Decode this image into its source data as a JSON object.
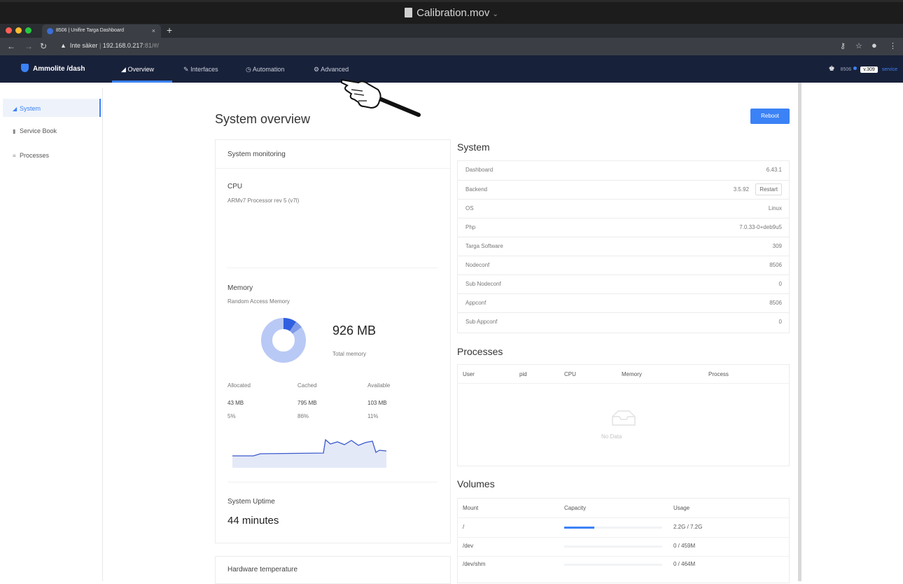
{
  "player": {
    "title": "Calibration.mov"
  },
  "browser": {
    "tab_title": "8506 | Unifire Targa Dashboard",
    "tab_close": "×",
    "new_tab": "+",
    "insecure": "Inte säker",
    "url_host": "192.168.0.217",
    "url_rest": ":81/#/"
  },
  "app": {
    "brand": "Ammolite /dash",
    "nav": {
      "overview": "Overview",
      "interfaces": "Interfaces",
      "automation": "Automation",
      "advanced": "Advanced"
    },
    "node": "8506",
    "version": "v.309",
    "service": "service"
  },
  "sidebar": {
    "items": [
      {
        "label": "System"
      },
      {
        "label": "Service Book"
      },
      {
        "label": "Processes"
      }
    ]
  },
  "page": {
    "title": "System overview",
    "reboot": "Reboot"
  },
  "monitoring": {
    "header": "System monitoring",
    "cpu_title": "CPU",
    "cpu_desc": "ARMv7 Processor rev 5 (v7l)",
    "mem_title": "Memory",
    "mem_desc": "Random Access Memory",
    "total": "926 MB",
    "total_label": "Total memory",
    "cols": [
      "Allocated",
      "Cached",
      "Available"
    ],
    "values": [
      "43 MB",
      "795 MB",
      "103 MB"
    ],
    "percents": [
      "5%",
      "86%",
      "11%"
    ],
    "alloc_pct": 5,
    "cached_pct": 86,
    "avail_pct": 11,
    "uptime_title": "System Uptime",
    "uptime": "44 minutes",
    "hw_title": "Hardware temperature"
  },
  "system": {
    "title": "System",
    "rows": [
      {
        "k": "Dashboard",
        "v": "6.43.1"
      },
      {
        "k": "Backend",
        "v": "3.5.92"
      },
      {
        "k": "OS",
        "v": "Linux"
      },
      {
        "k": "Php",
        "v": "7.0.33-0+deb9u5"
      },
      {
        "k": "Targa Software",
        "v": "309"
      },
      {
        "k": "Nodeconf",
        "v": "8506"
      },
      {
        "k": "Sub Nodeconf",
        "v": "0"
      },
      {
        "k": "Appconf",
        "v": "8506"
      },
      {
        "k": "Sub Appconf",
        "v": "0"
      }
    ],
    "restart": "Restart"
  },
  "processes": {
    "title": "Processes",
    "cols": [
      "User",
      "pid",
      "CPU",
      "Memory",
      "Process"
    ],
    "empty": "No Data"
  },
  "volumes": {
    "title": "Volumes",
    "cols": [
      "Mount",
      "Capacity",
      "Usage"
    ],
    "rows": [
      {
        "mount": "/",
        "usage": "2.2G / 7.2G",
        "pct": 31
      },
      {
        "mount": "/dev",
        "usage": "0 / 459M",
        "pct": 0
      },
      {
        "mount": "/dev/shm",
        "usage": "0 / 464M",
        "pct": 0
      }
    ]
  },
  "colors": {
    "accent": "#3b82f6",
    "nav_bg": "#18213a"
  }
}
